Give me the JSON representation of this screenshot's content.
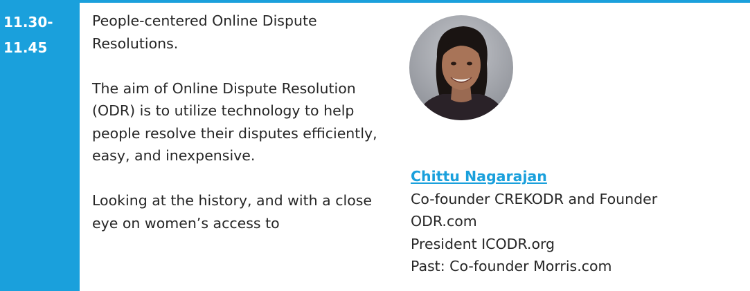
{
  "session": {
    "time_start": "11.30-",
    "time_end": "11.45"
  },
  "description": {
    "paragraphs": [
      "People-centered Online Dispute Resolutions.",
      "The aim of Online Dispute Resolution (ODR) is to utilize technology to help people resolve their disputes efficiently, easy, and inexpensive.",
      "Looking at the history, and with a close eye on women’s access to"
    ]
  },
  "speaker": {
    "photo_icon": "speaker-portrait",
    "name": "Chittu Nagarajan",
    "lines": [
      "Co-founder CREKODR and Founder",
      "ODR.com",
      "President ICODR.org",
      "Past: Co-founder Morris.com"
    ]
  },
  "colors": {
    "accent": "#1aa0dc",
    "text": "#262626"
  }
}
